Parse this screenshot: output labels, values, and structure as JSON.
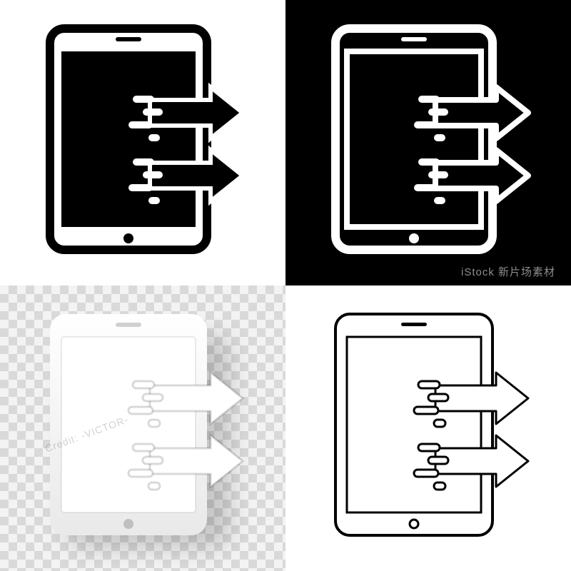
{
  "icon_name": "tablet-data-transfer-icon",
  "variants": [
    {
      "id": "solid-on-white",
      "bg": "#ffffff",
      "style": "solid",
      "stroke": "#000000",
      "fill": "#000000"
    },
    {
      "id": "outline-on-black",
      "bg": "#000000",
      "style": "outline",
      "stroke": "#ffffff",
      "fill": "none"
    },
    {
      "id": "white-on-transparent",
      "bg": "transparent",
      "style": "white3d",
      "stroke": "#ffffff",
      "fill": "#ffffff"
    },
    {
      "id": "thin-outline-on-white",
      "bg": "#ffffff",
      "style": "thin",
      "stroke": "#000000",
      "fill": "none"
    }
  ],
  "watermarks": {
    "top_right": "iStock 新片场素材",
    "bottom_left": "Credit: -VICTOR-"
  }
}
